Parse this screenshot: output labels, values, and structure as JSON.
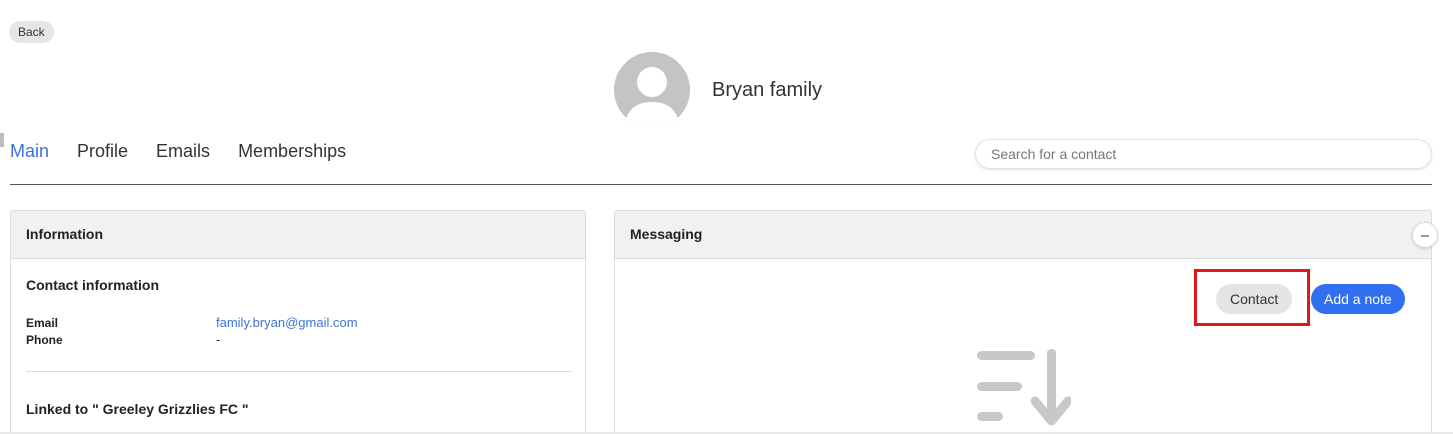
{
  "header": {
    "back_label": "Back",
    "family_name": "Bryan family"
  },
  "tabs": [
    {
      "label": "Main",
      "active": true
    },
    {
      "label": "Profile",
      "active": false
    },
    {
      "label": "Emails",
      "active": false
    },
    {
      "label": "Memberships",
      "active": false
    }
  ],
  "search": {
    "placeholder": "Search for a contact",
    "value": ""
  },
  "information": {
    "title": "Information",
    "contact_info_title": "Contact information",
    "email_label": "Email",
    "email_value": "family.bryan@gmail.com",
    "phone_label": "Phone",
    "phone_value": "-",
    "linked_to": "Linked to \" Greeley Grizzlies FC \""
  },
  "messaging": {
    "title": "Messaging",
    "contact_label": "Contact",
    "add_note_label": "Add a note",
    "empty_icon": "sort-descending-icon",
    "collapse_icon": "minus-icon"
  },
  "colors": {
    "accent": "#3b72d9",
    "primary_button": "#2f6ff0",
    "highlight": "#e11818"
  }
}
